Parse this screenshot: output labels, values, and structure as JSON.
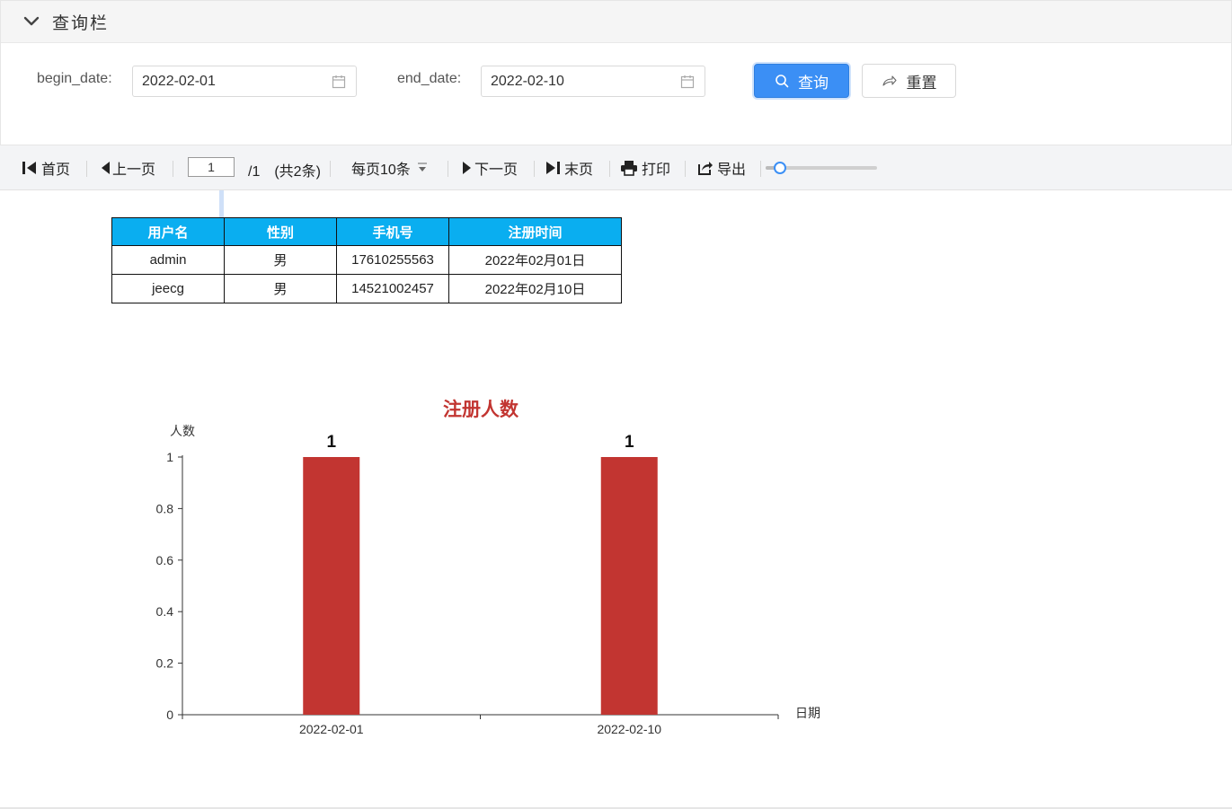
{
  "query_panel": {
    "title": "查询栏",
    "begin_label": "begin_date:",
    "begin_value": "2022-02-01",
    "end_label": "end_date:",
    "end_value": "2022-02-10",
    "query_button": "查询",
    "reset_button": "重置",
    "accent_color": "#3b8ff5"
  },
  "toolbar": {
    "first_page": "首页",
    "prev_page": "上一页",
    "current_page": "1",
    "page_total": "/1　(共2条)",
    "page_size": "每页10条",
    "next_page": "下一页",
    "last_page": "末页",
    "print": "打印",
    "export": "导出",
    "zoom_level": 0.1
  },
  "table": {
    "headers": [
      "用户名",
      "性别",
      "手机号",
      "注册时间"
    ],
    "rows": [
      [
        "admin",
        "男",
        "17610255563",
        "2022年02月01日"
      ],
      [
        "jeecg",
        "男",
        "14521002457",
        "2022年02月10日"
      ]
    ],
    "header_color": "#0aaef0"
  },
  "chart_data": {
    "type": "bar",
    "title": "注册人数",
    "xlabel": "日期",
    "ylabel": "人数",
    "categories": [
      "2022-02-01",
      "2022-02-10"
    ],
    "values": [
      1,
      1
    ],
    "ylim": [
      0,
      1
    ],
    "yticks": [
      "0",
      "0.2",
      "0.4",
      "0.6",
      "0.8",
      "1"
    ],
    "data_labels": [
      "1",
      "1"
    ],
    "bar_color": "#c23531",
    "title_color": "#c23531",
    "grid": false
  }
}
